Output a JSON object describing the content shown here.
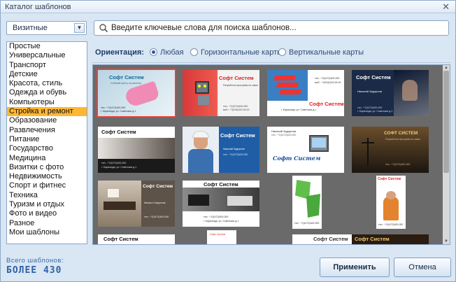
{
  "window": {
    "title": "Каталог шаблонов",
    "close_glyph": "✕"
  },
  "category_select": {
    "value": "Визитные",
    "arrow": "▼"
  },
  "search": {
    "placeholder": "Введите ключевые слова для поиска шаблонов..."
  },
  "categories": {
    "items": [
      "Простые",
      "Универсальные",
      "Транспорт",
      "Детские",
      "Красота, стиль",
      "Одежда и обувь",
      "Компьютеры",
      "Стройка и ремонт",
      "Образование",
      "Развлечения",
      "Питание",
      "Государство",
      "Медицина",
      "Визитки с фото",
      "Недвижимость",
      "Спорт и фитнес",
      "Техника",
      "Туризм и отдых",
      "Фото и видео",
      "Разное",
      "Мои шаблоны"
    ],
    "selected_index": 7
  },
  "orientation": {
    "label": "Ориентация:",
    "options": [
      "Любая",
      "Горизонтальные карты",
      "Вертикальные карты"
    ],
    "selected_index": 0
  },
  "cards": {
    "company": "Софт Систем",
    "company_caps": "СОФТ СИСТЕМ",
    "person_1": "Николай Задорнов",
    "person_2": "Михаил Сафронов",
    "person_3": "Максим Задорнов",
    "phone": "тел.: +7(4472)400-000",
    "phone_2": "моб.: +7(916)100-00-00",
    "address": "г. Караганда, ул. Советская д.1",
    "slogan": "Разработка программ на заказ",
    "slogan_2": "Учебный центр по ремонту"
  },
  "footer": {
    "total_label": "Всего шаблонов:",
    "total_value": "БОЛЕЕ 430",
    "apply_label": "Применить",
    "cancel_label": "Отмена"
  },
  "colors": {
    "selected_category": "#ffb733",
    "selection_outline": "#e8423a",
    "accent": "#2f62a6"
  }
}
